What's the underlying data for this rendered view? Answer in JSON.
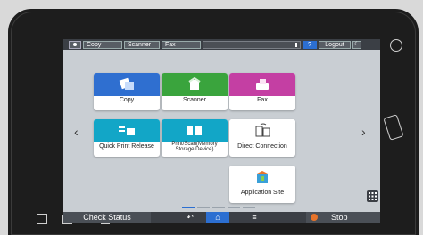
{
  "topbar": {
    "tabs": [
      "Copy",
      "Scanner",
      "Fax"
    ],
    "help_label": "?",
    "logout_label": "Logout",
    "moon_label": "☾"
  },
  "apps": [
    {
      "label": "Copy",
      "color": "#2f6fd0",
      "icon": "copy-icon"
    },
    {
      "label": "Scanner",
      "color": "#3aa43d",
      "icon": "scanner-icon"
    },
    {
      "label": "Fax",
      "color": "#c43fa3",
      "icon": "fax-icon"
    },
    {
      "label": "Quick Print Release",
      "color": "#12a6c7",
      "icon": "quick-print-icon"
    },
    {
      "label_line1": "Print/Scan(Memory",
      "label_line2": "Storage Device)",
      "color": "#12a6c7",
      "icon": "memory-storage-icon"
    },
    {
      "label": "Direct Connection",
      "color": "#ffffff",
      "icon": "direct-connection-icon"
    },
    {
      "label": "Application Site",
      "color": "#ffffff",
      "icon": "application-site-icon"
    }
  ],
  "nav": {
    "prev": "‹",
    "next": "›"
  },
  "bottombar": {
    "check_status": "Check Status",
    "stop": "Stop"
  }
}
